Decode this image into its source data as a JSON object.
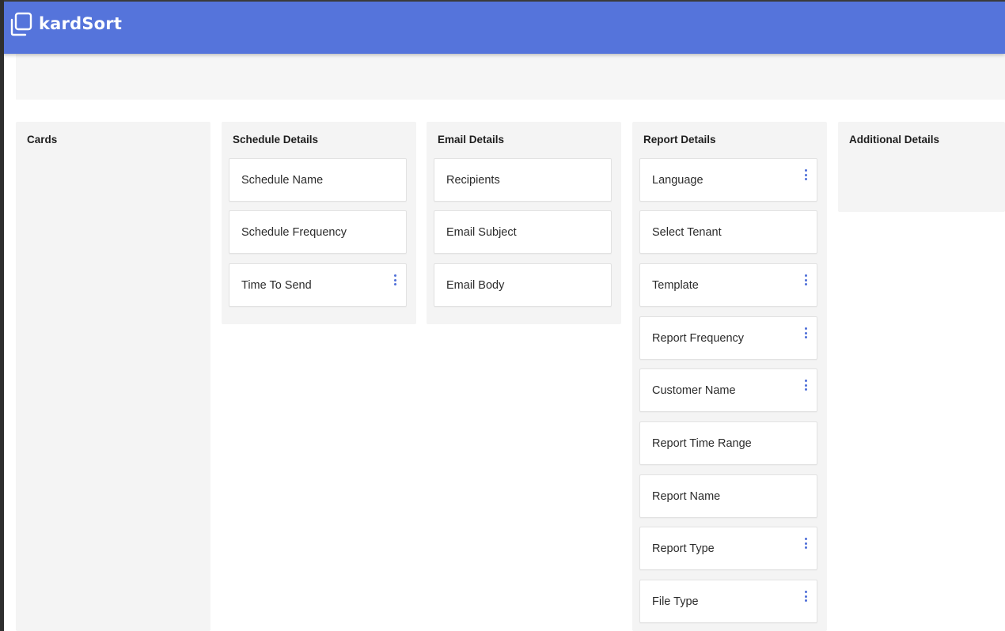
{
  "app": {
    "name": "kardSort",
    "logo_icon": "stacked-cards-icon",
    "colors": {
      "appbar": "#5574db",
      "menu_dots": "#4f6fd8",
      "column_bg": "#f4f4f4",
      "card_bg": "#ffffff"
    }
  },
  "columns": [
    {
      "title": "Cards",
      "cards": []
    },
    {
      "title": "Schedule Details",
      "cards": [
        {
          "label": "Schedule Name",
          "has_menu": false
        },
        {
          "label": "Schedule Frequency",
          "has_menu": false
        },
        {
          "label": "Time To Send",
          "has_menu": true
        }
      ]
    },
    {
      "title": "Email Details",
      "cards": [
        {
          "label": "Recipients",
          "has_menu": false
        },
        {
          "label": "Email Subject",
          "has_menu": false
        },
        {
          "label": "Email Body",
          "has_menu": false
        }
      ]
    },
    {
      "title": "Report Details",
      "cards": [
        {
          "label": "Language",
          "has_menu": true
        },
        {
          "label": "Select Tenant",
          "has_menu": false
        },
        {
          "label": "Template",
          "has_menu": true
        },
        {
          "label": "Report Frequency",
          "has_menu": true
        },
        {
          "label": "Customer Name",
          "has_menu": true
        },
        {
          "label": "Report Time Range",
          "has_menu": false
        },
        {
          "label": "Report Name",
          "has_menu": false
        },
        {
          "label": "Report Type",
          "has_menu": true
        },
        {
          "label": "File Type",
          "has_menu": true
        }
      ]
    },
    {
      "title": "Additional Details",
      "cards": []
    }
  ]
}
